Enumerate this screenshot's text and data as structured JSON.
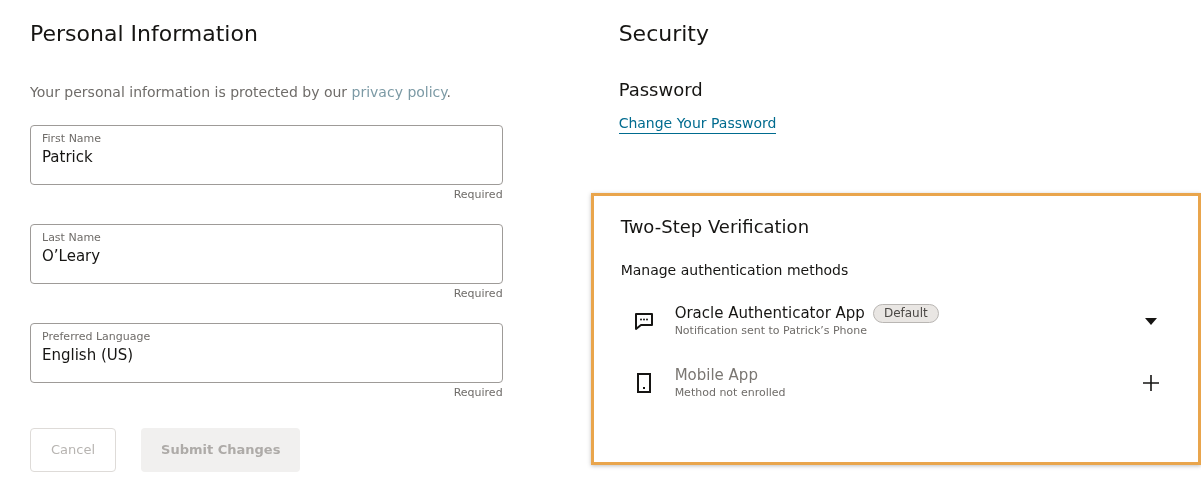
{
  "personal": {
    "title": "Personal Information",
    "notice": "Your personal information is protected by our ",
    "notice_link": "privacy policy",
    "notice_end": ".",
    "fields": [
      {
        "label": "First Name",
        "value": "Patrick",
        "hint": "Required"
      },
      {
        "label": "Last Name",
        "value": "O’Leary",
        "hint": "Required"
      },
      {
        "label": "Preferred Language",
        "value": "English (US)",
        "hint": "Required"
      }
    ],
    "buttons": [
      {
        "label": "Cancel",
        "kind": "outline",
        "disabled": true
      },
      {
        "label": "Submit Changes",
        "kind": "solid",
        "disabled": true
      }
    ]
  },
  "security": {
    "title": "Security",
    "password_heading": "Password",
    "password_link": "Change Your Password",
    "two_step": {
      "title": "Two-Step Verification",
      "subtitle": "Manage authentication methods",
      "highlighted": true,
      "methods": [
        {
          "kind": "notification",
          "name": "Oracle Authenticator App",
          "badge": "Default",
          "detail": "Notification sent to Patrick’s Phone",
          "enrolled": true
        },
        {
          "kind": "device",
          "name": "Mobile App",
          "detail": "Method not enrolled",
          "enrolled": false
        }
      ]
    }
  }
}
